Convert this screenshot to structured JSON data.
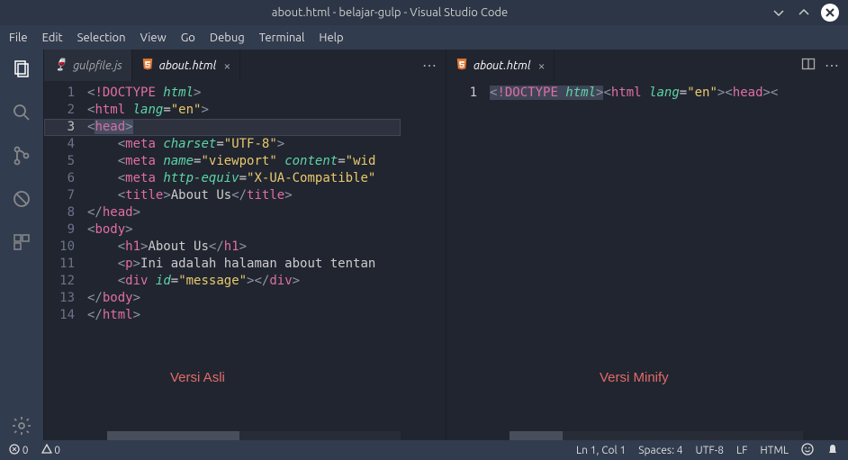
{
  "window": {
    "title": "about.html - belajar-gulp - Visual Studio Code"
  },
  "menu": {
    "file": "File",
    "edit": "Edit",
    "selection": "Selection",
    "view": "View",
    "go": "Go",
    "debug": "Debug",
    "terminal": "Terminal",
    "help": "Help"
  },
  "tabs": {
    "left": [
      {
        "label": "gulpfile.js",
        "icon": "gulp",
        "active": false,
        "close": false
      },
      {
        "label": "about.html",
        "icon": "html5",
        "active": true,
        "close": true
      }
    ],
    "right": [
      {
        "label": "about.html",
        "icon": "html5",
        "active": true,
        "close": true
      }
    ]
  },
  "code": {
    "left": {
      "active_line": 3,
      "lines": [
        {
          "n": 1,
          "seg": [
            [
              "<",
              "punct"
            ],
            [
              "!DOCTYPE ",
              "doctype"
            ],
            [
              "html",
              "html"
            ],
            [
              ">",
              "punct"
            ]
          ]
        },
        {
          "n": 2,
          "seg": [
            [
              "<",
              "punct"
            ],
            [
              "html",
              "tag"
            ],
            [
              " ",
              ""
            ],
            [
              "lang",
              "attr"
            ],
            [
              "=",
              "op"
            ],
            [
              "\"en\"",
              "str"
            ],
            [
              ">",
              "punct"
            ]
          ]
        },
        {
          "n": 3,
          "seg": [
            [
              "<",
              "punct"
            ],
            [
              "head",
              "tag"
            ],
            [
              ">",
              "punct"
            ]
          ],
          "head_sel": true
        },
        {
          "n": 4,
          "seg": [
            [
              "    <",
              "punct"
            ],
            [
              "meta",
              "tag"
            ],
            [
              " ",
              ""
            ],
            [
              "charset",
              "attr"
            ],
            [
              "=",
              "op"
            ],
            [
              "\"UTF-8\"",
              "str"
            ],
            [
              ">",
              "punct"
            ]
          ]
        },
        {
          "n": 5,
          "seg": [
            [
              "    <",
              "punct"
            ],
            [
              "meta",
              "tag"
            ],
            [
              " ",
              ""
            ],
            [
              "name",
              "attr"
            ],
            [
              "=",
              "op"
            ],
            [
              "\"viewport\"",
              "str"
            ],
            [
              " ",
              ""
            ],
            [
              "content",
              "attr"
            ],
            [
              "=",
              "op"
            ],
            [
              "\"wid",
              "str"
            ]
          ]
        },
        {
          "n": 6,
          "seg": [
            [
              "    <",
              "punct"
            ],
            [
              "meta",
              "tag"
            ],
            [
              " ",
              ""
            ],
            [
              "http-equiv",
              "attr"
            ],
            [
              "=",
              "op"
            ],
            [
              "\"X-UA-Compatible\"",
              "str"
            ]
          ]
        },
        {
          "n": 7,
          "seg": [
            [
              "    <",
              "punct"
            ],
            [
              "title",
              "tag"
            ],
            [
              ">",
              "punct"
            ],
            [
              "About Us",
              ""
            ],
            [
              "</",
              "punct"
            ],
            [
              "title",
              "tag"
            ],
            [
              ">",
              "punct"
            ]
          ]
        },
        {
          "n": 8,
          "seg": [
            [
              "</",
              "punct"
            ],
            [
              "head",
              "tag"
            ],
            [
              ">",
              "punct"
            ]
          ]
        },
        {
          "n": 9,
          "seg": [
            [
              "<",
              "punct"
            ],
            [
              "body",
              "tag"
            ],
            [
              ">",
              "punct"
            ]
          ]
        },
        {
          "n": 10,
          "seg": [
            [
              "    <",
              "punct"
            ],
            [
              "h1",
              "tag"
            ],
            [
              ">",
              "punct"
            ],
            [
              "About Us",
              ""
            ],
            [
              "</",
              "punct"
            ],
            [
              "h1",
              "tag"
            ],
            [
              ">",
              "punct"
            ]
          ]
        },
        {
          "n": 11,
          "seg": [
            [
              "    <",
              "punct"
            ],
            [
              "p",
              "tag"
            ],
            [
              ">",
              "punct"
            ],
            [
              "Ini adalah halaman about tentan",
              ""
            ]
          ]
        },
        {
          "n": 12,
          "seg": [
            [
              "    <",
              "punct"
            ],
            [
              "div",
              "tag"
            ],
            [
              " ",
              ""
            ],
            [
              "id",
              "attr"
            ],
            [
              "=",
              "op"
            ],
            [
              "\"message\"",
              "str"
            ],
            [
              "></",
              "punct"
            ],
            [
              "div",
              "tag"
            ],
            [
              ">",
              "punct"
            ]
          ]
        },
        {
          "n": 13,
          "seg": [
            [
              "</",
              "punct"
            ],
            [
              "body",
              "tag"
            ],
            [
              ">",
              "punct"
            ]
          ]
        },
        {
          "n": 14,
          "seg": [
            [
              "</",
              "punct"
            ],
            [
              "html",
              "tag"
            ],
            [
              ">",
              "punct"
            ]
          ]
        }
      ],
      "annotation": "Versi Asli"
    },
    "right": {
      "active_line": 1,
      "lines": [
        {
          "n": 1,
          "seg": [
            [
              "<",
              "punct"
            ],
            [
              "!DOCTYPE ",
              "doctype"
            ],
            [
              "html",
              "html"
            ],
            [
              ">",
              "punct"
            ],
            [
              "<",
              "punct"
            ],
            [
              "html",
              "tag"
            ],
            [
              " ",
              ""
            ],
            [
              "lang",
              "attr"
            ],
            [
              "=",
              "op"
            ],
            [
              "\"en\"",
              "str"
            ],
            [
              "><",
              "punct"
            ],
            [
              "head",
              "tag"
            ],
            [
              "><",
              "punct"
            ]
          ],
          "doctype_sel": true
        }
      ],
      "annotation": "Versi Minify"
    }
  },
  "status": {
    "errors": "0",
    "warnings": "0",
    "ln_col": "Ln 1, Col 1",
    "spaces": "Spaces: 4",
    "encoding": "UTF-8",
    "eol": "LF",
    "lang": "HTML"
  }
}
